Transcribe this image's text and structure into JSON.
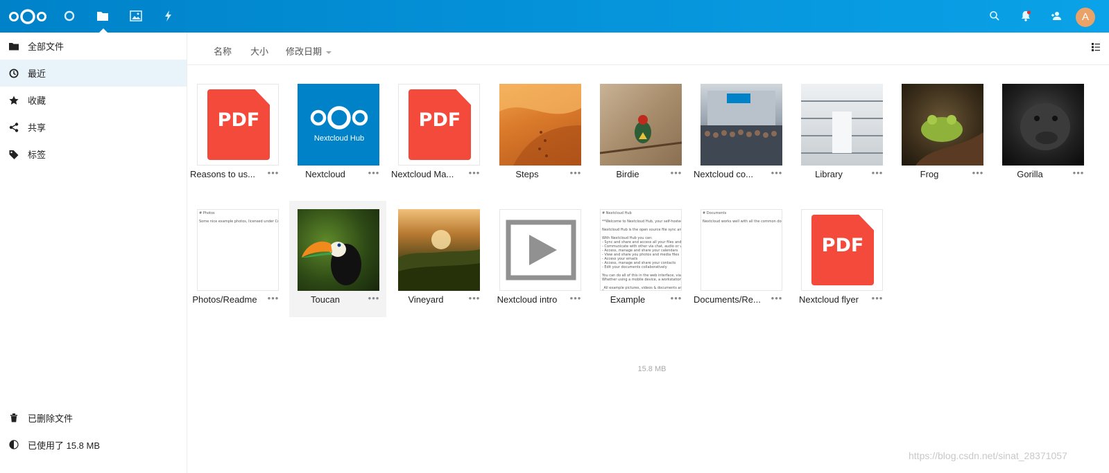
{
  "header": {
    "apps": [
      {
        "name": "dashboard-icon"
      },
      {
        "name": "files-icon"
      },
      {
        "name": "photos-icon"
      },
      {
        "name": "activity-icon"
      }
    ],
    "right_icons": [
      "search-icon",
      "notifications-icon",
      "contacts-icon"
    ],
    "avatar_initial": "A",
    "colors": {
      "header_start": "#0082c9",
      "header_end": "#0aa2e8",
      "avatar": "#e9a267"
    }
  },
  "sidebar": {
    "items": [
      {
        "label": "全部文件",
        "icon": "folder-icon"
      },
      {
        "label": "最近",
        "icon": "clock-icon",
        "active": true
      },
      {
        "label": "收藏",
        "icon": "star-icon"
      },
      {
        "label": "共享",
        "icon": "share-icon"
      },
      {
        "label": "标签",
        "icon": "tag-icon"
      }
    ],
    "trash_label": "已删除文件",
    "quota_label": "已使用了 15.8 MB"
  },
  "sort": {
    "name": "名称",
    "size": "大小",
    "modified": "修改日期"
  },
  "files_row1": [
    {
      "name": "Reasons to us...",
      "type": "pdf"
    },
    {
      "name": "Nextcloud",
      "type": "nextcloud-hub",
      "thumb_text": "Nextcloud Hub"
    },
    {
      "name": "Nextcloud Ma...",
      "type": "pdf"
    },
    {
      "name": "Steps",
      "type": "image-desert"
    },
    {
      "name": "Birdie",
      "type": "image-bird"
    },
    {
      "name": "Nextcloud co...",
      "type": "image-crowd"
    },
    {
      "name": "Library",
      "type": "image-library"
    },
    {
      "name": "Frog",
      "type": "image-frog"
    },
    {
      "name": "Gorilla",
      "type": "image-gorilla"
    }
  ],
  "files_row2": [
    {
      "name": "Photos/Readme",
      "type": "text",
      "thumb_text": "# Photos\n\nSome nice example photos, licensed under Creative"
    },
    {
      "name": "Toucan",
      "type": "image-toucan"
    },
    {
      "name": "Vineyard",
      "type": "image-vineyard"
    },
    {
      "name": "Nextcloud intro",
      "type": "video"
    },
    {
      "name": "Example",
      "type": "text",
      "thumb_text": "# Nextcloud Hub\n\n**Welcome to Nextcloud Hub, your self-hosted coll\n\nNextcloud Hub is the open source file sync and sha\n\nWith Nextcloud Hub you can:\n- Sync and share and access all your files and docum\n- Communicate with other via chat, audio or video c\n- Access, manage and share your calendars\n- View and share you photos and media files\n- Access your emails\n- Access, manage and share your contacts\n- Edit your documents collaboratively\n\nYou can do all of this in the web interface, via you d\nWhether using a mobile device, a workstation, or a\n\n_All example pictures, videos & documents are licer"
    },
    {
      "name": "Documents/Re...",
      "type": "text",
      "thumb_text": "# Documents\n\nNextcloud works well with all the common docume"
    },
    {
      "name": "Nextcloud flyer",
      "type": "pdf"
    }
  ],
  "pdf_label": "PDF",
  "folder_size": "15.8 MB",
  "more_glyph": "•••",
  "watermark": "https://blog.csdn.net/sinat_28371057"
}
